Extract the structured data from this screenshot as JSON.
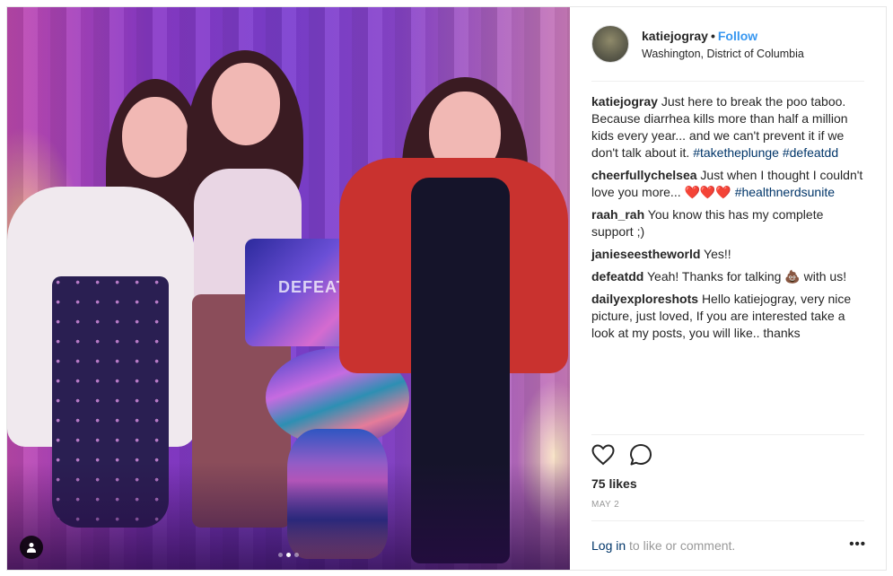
{
  "post": {
    "photo": {
      "printed_text": "DEFEATDD",
      "carousel": {
        "count": 3,
        "active_index": 1
      }
    },
    "header": {
      "username": "katiejogray",
      "separator": "•",
      "follow_label": "Follow",
      "location": "Washington, District of Columbia"
    },
    "comments": [
      {
        "user": "katiejogray",
        "text": "Just here to break the poo taboo. Because diarrhea kills more than half a million kids every year... and we can't prevent it if we don't talk about it.",
        "tags": "#taketheplunge #defeatdd"
      },
      {
        "user": "cheerfullychelsea",
        "text": "Just when I thought I couldn't love you more... ❤️❤️❤️",
        "tags": "#healthnerdsunite"
      },
      {
        "user": "raah_rah",
        "text": "You know this has my complete support ;)",
        "tags": ""
      },
      {
        "user": "janieseestheworld",
        "text": "Yes!!",
        "tags": ""
      },
      {
        "user": "defeatdd",
        "text": "Yeah! Thanks for talking 💩 with us!",
        "tags": ""
      },
      {
        "user": "dailyexploreshots",
        "text": "Hello katiejogray, very nice picture, just loved, If you are interested take a look at my posts, you will like.. thanks",
        "tags": ""
      }
    ],
    "actions": {
      "like_icon": "heart-icon",
      "comment_icon": "comment-bubble-icon"
    },
    "likes": "75 likes",
    "date": "MAY 2",
    "login": {
      "link": "Log in",
      "rest": " to like or comment."
    },
    "more": "•••",
    "colors": {
      "link_blue": "#3897f0",
      "tag_blue": "#003569",
      "muted": "#999999"
    }
  }
}
